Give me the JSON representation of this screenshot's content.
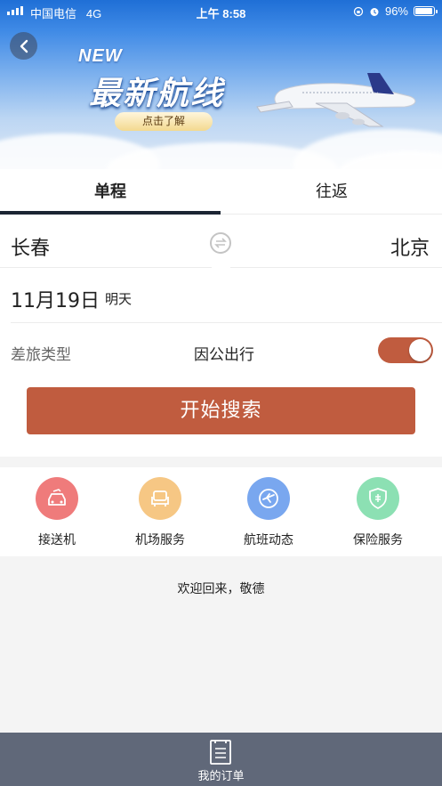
{
  "status_bar": {
    "carrier": "中国电信",
    "network": "4G",
    "time": "上午 8:58",
    "battery": "96%",
    "battery_level": 0.96
  },
  "banner": {
    "new_tag": "NEW",
    "title": "最新航线",
    "cta": "点击了解"
  },
  "tabs": [
    {
      "label": "单程",
      "active": true
    },
    {
      "label": "往返",
      "active": false
    }
  ],
  "route": {
    "from": "长春",
    "to": "北京"
  },
  "date": {
    "value": "11月19日",
    "note": "明天"
  },
  "trip_type": {
    "label": "差旅类型",
    "value": "因公出行",
    "toggle_on": true
  },
  "search_button": "开始搜索",
  "services": [
    {
      "label": "接送机",
      "icon": "car-icon",
      "color": "#ef7b7b"
    },
    {
      "label": "机场服务",
      "icon": "seat-icon",
      "color": "#f6c784"
    },
    {
      "label": "航班动态",
      "icon": "flight-icon",
      "color": "#79a7ef"
    },
    {
      "label": "保险服务",
      "icon": "shield-icon",
      "color": "#8ce0b3"
    }
  ],
  "welcome": "欢迎回来，敬德",
  "bottom_nav": {
    "label": "我的订单",
    "icon": "order-list-icon"
  },
  "colors": {
    "accent": "#c05c3f",
    "tab_indicator": "#1b2533",
    "bottom_bar": "#606879"
  }
}
